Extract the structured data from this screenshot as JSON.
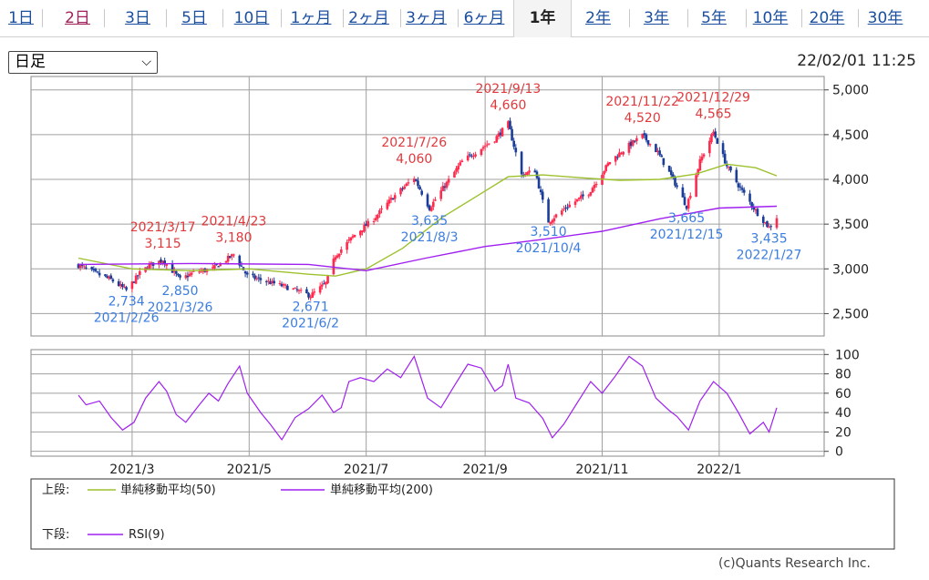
{
  "tabs": [
    {
      "label": "1日",
      "state": "link"
    },
    {
      "label": "2日",
      "state": "visited"
    },
    {
      "label": "3日",
      "state": "link"
    },
    {
      "label": "5日",
      "state": "link"
    },
    {
      "label": "10日",
      "state": "link"
    },
    {
      "label": "1ヶ月",
      "state": "link"
    },
    {
      "label": "2ヶ月",
      "state": "link"
    },
    {
      "label": "3ヶ月",
      "state": "link"
    },
    {
      "label": "6ヶ月",
      "state": "link"
    },
    {
      "label": "1年",
      "state": "active"
    },
    {
      "label": "2年",
      "state": "link"
    },
    {
      "label": "3年",
      "state": "link"
    },
    {
      "label": "5年",
      "state": "link"
    },
    {
      "label": "10年",
      "state": "link"
    },
    {
      "label": "20年",
      "state": "link"
    },
    {
      "label": "30年",
      "state": "link"
    }
  ],
  "period_select": {
    "value": "日足"
  },
  "timestamp": "22/02/01 11:25",
  "credit": "(c)Quants Research Inc.",
  "legend": {
    "upper_label": "上段:",
    "lower_label": "下段:",
    "sma50": "単純移動平均(50)",
    "sma200": "単純移動平均(200)",
    "rsi": "RSI(9)"
  },
  "colors": {
    "candle_up": "#ff2a4d",
    "candle_down": "#1b3d99",
    "sma50": "#9dc12d",
    "sma200": "#a020f0",
    "rsi": "#a020f0",
    "high_label": "#e0393c",
    "low_label": "#3b7de0",
    "grid": "#a0a0a0"
  },
  "chart_data": [
    {
      "type": "line",
      "subtype": "candlestick",
      "x_range": [
        "2021-02-01",
        "2022-01-31"
      ],
      "x_ticks": [
        "2021/3",
        "2021/5",
        "2021/7",
        "2021/9",
        "2021/11",
        "2022/1"
      ],
      "ylim": [
        2250,
        5150
      ],
      "y_ticks": [
        "5,000",
        "4,500",
        "4,000",
        "3,500",
        "3,000",
        "2,500"
      ],
      "y_tick_values": [
        5000,
        4500,
        4000,
        3500,
        3000,
        2500
      ],
      "price_path": [
        [
          "2021-02-01",
          3040
        ],
        [
          "2021-02-10",
          2950
        ],
        [
          "2021-02-18",
          2880
        ],
        [
          "2021-02-26",
          2760
        ],
        [
          "2021-03-05",
          2950
        ],
        [
          "2021-03-10",
          3040
        ],
        [
          "2021-03-17",
          3100
        ],
        [
          "2021-03-26",
          2880
        ],
        [
          "2021-04-02",
          2960
        ],
        [
          "2021-04-12",
          3000
        ],
        [
          "2021-04-23",
          3160
        ],
        [
          "2021-04-30",
          2920
        ],
        [
          "2021-05-10",
          2860
        ],
        [
          "2021-05-20",
          2800
        ],
        [
          "2021-06-02",
          2700
        ],
        [
          "2021-06-10",
          2840
        ],
        [
          "2021-06-15",
          3150
        ],
        [
          "2021-06-25",
          3380
        ],
        [
          "2021-07-05",
          3560
        ],
        [
          "2021-07-15",
          3800
        ],
        [
          "2021-07-26",
          4020
        ],
        [
          "2021-08-03",
          3680
        ],
        [
          "2021-08-10",
          3900
        ],
        [
          "2021-08-20",
          4200
        ],
        [
          "2021-08-30",
          4350
        ],
        [
          "2021-09-06",
          4450
        ],
        [
          "2021-09-13",
          4620
        ],
        [
          "2021-09-20",
          4050
        ],
        [
          "2021-09-27",
          4100
        ],
        [
          "2021-10-01",
          3750
        ],
        [
          "2021-10-04",
          3530
        ],
        [
          "2021-10-14",
          3700
        ],
        [
          "2021-10-25",
          3850
        ],
        [
          "2021-11-05",
          4200
        ],
        [
          "2021-11-15",
          4380
        ],
        [
          "2021-11-22",
          4490
        ],
        [
          "2021-11-30",
          4300
        ],
        [
          "2021-12-08",
          4000
        ],
        [
          "2021-12-15",
          3700
        ],
        [
          "2021-12-22",
          4200
        ],
        [
          "2021-12-29",
          4530
        ],
        [
          "2022-01-05",
          4150
        ],
        [
          "2022-01-12",
          3900
        ],
        [
          "2022-01-20",
          3650
        ],
        [
          "2022-01-27",
          3460
        ],
        [
          "2022-01-31",
          3580
        ]
      ],
      "series": [
        {
          "name": "単純移動平均(50)",
          "values": [
            [
              "2021-02-01",
              3120
            ],
            [
              "2021-03-01",
              3000
            ],
            [
              "2021-04-01",
              2980
            ],
            [
              "2021-05-01",
              3000
            ],
            [
              "2021-06-01",
              2940
            ],
            [
              "2021-06-15",
              2920
            ],
            [
              "2021-07-01",
              3000
            ],
            [
              "2021-07-20",
              3230
            ],
            [
              "2021-08-10",
              3580
            ],
            [
              "2021-09-01",
              3870
            ],
            [
              "2021-09-13",
              4030
            ],
            [
              "2021-10-01",
              4050
            ],
            [
              "2021-10-20",
              4020
            ],
            [
              "2021-11-10",
              3990
            ],
            [
              "2021-12-01",
              4000
            ],
            [
              "2021-12-20",
              4060
            ],
            [
              "2022-01-05",
              4170
            ],
            [
              "2022-01-20",
              4130
            ],
            [
              "2022-01-31",
              4040
            ]
          ]
        },
        {
          "name": "単純移動平均(200)",
          "values": [
            [
              "2021-02-01",
              3050
            ],
            [
              "2021-04-01",
              3060
            ],
            [
              "2021-06-01",
              3050
            ],
            [
              "2021-07-01",
              2980
            ],
            [
              "2021-08-01",
              3120
            ],
            [
              "2021-09-01",
              3250
            ],
            [
              "2021-10-01",
              3330
            ],
            [
              "2021-11-01",
              3420
            ],
            [
              "2021-12-01",
              3560
            ],
            [
              "2022-01-01",
              3680
            ],
            [
              "2022-01-31",
              3700
            ]
          ]
        }
      ],
      "annotations": [
        {
          "date": "2021/3/17",
          "value": "3,115",
          "kind": "high"
        },
        {
          "date": "2021/4/23",
          "value": "3,180",
          "kind": "high"
        },
        {
          "date": "2021/7/26",
          "value": "4,060",
          "kind": "high"
        },
        {
          "date": "2021/9/13",
          "value": "4,660",
          "kind": "high"
        },
        {
          "date": "2021/11/22",
          "value": "4,520",
          "kind": "high"
        },
        {
          "date": "2021/12/29",
          "value": "4,565",
          "kind": "high"
        },
        {
          "date": "2021/2/26",
          "value": "2,734",
          "kind": "low"
        },
        {
          "date": "2021/3/26",
          "value": "2,850",
          "kind": "low"
        },
        {
          "date": "2021/6/2",
          "value": "2,671",
          "kind": "low"
        },
        {
          "date": "2021/8/3",
          "value": "3,635",
          "kind": "low"
        },
        {
          "date": "2021/10/4",
          "value": "3,510",
          "kind": "low"
        },
        {
          "date": "2021/12/15",
          "value": "3,665",
          "kind": "low"
        },
        {
          "date": "2022/1/27",
          "value": "3,435",
          "kind": "low"
        }
      ]
    },
    {
      "type": "line",
      "ylim": [
        -5,
        105
      ],
      "y_ticks": [
        "100",
        "80",
        "60",
        "40",
        "20",
        "0"
      ],
      "y_tick_values": [
        100,
        80,
        60,
        40,
        20,
        0
      ],
      "series": [
        {
          "name": "RSI(9)",
          "values": [
            [
              "2021-02-01",
              58
            ],
            [
              "2021-02-05",
              48
            ],
            [
              "2021-02-12",
              52
            ],
            [
              "2021-02-18",
              35
            ],
            [
              "2021-02-24",
              22
            ],
            [
              "2021-03-02",
              30
            ],
            [
              "2021-03-08",
              55
            ],
            [
              "2021-03-15",
              72
            ],
            [
              "2021-03-19",
              62
            ],
            [
              "2021-03-24",
              38
            ],
            [
              "2021-03-29",
              30
            ],
            [
              "2021-04-05",
              48
            ],
            [
              "2021-04-10",
              60
            ],
            [
              "2021-04-15",
              52
            ],
            [
              "2021-04-20",
              70
            ],
            [
              "2021-04-26",
              88
            ],
            [
              "2021-04-30",
              60
            ],
            [
              "2021-05-07",
              40
            ],
            [
              "2021-05-12",
              28
            ],
            [
              "2021-05-18",
              12
            ],
            [
              "2021-05-25",
              35
            ],
            [
              "2021-06-01",
              44
            ],
            [
              "2021-06-08",
              58
            ],
            [
              "2021-06-14",
              40
            ],
            [
              "2021-06-18",
              45
            ],
            [
              "2021-06-22",
              72
            ],
            [
              "2021-06-28",
              76
            ],
            [
              "2021-07-05",
              72
            ],
            [
              "2021-07-12",
              85
            ],
            [
              "2021-07-19",
              76
            ],
            [
              "2021-07-26",
              98
            ],
            [
              "2021-08-02",
              55
            ],
            [
              "2021-08-09",
              45
            ],
            [
              "2021-08-16",
              68
            ],
            [
              "2021-08-23",
              90
            ],
            [
              "2021-08-30",
              86
            ],
            [
              "2021-09-06",
              62
            ],
            [
              "2021-09-10",
              68
            ],
            [
              "2021-09-13",
              90
            ],
            [
              "2021-09-17",
              55
            ],
            [
              "2021-09-24",
              50
            ],
            [
              "2021-10-01",
              34
            ],
            [
              "2021-10-06",
              14
            ],
            [
              "2021-10-12",
              28
            ],
            [
              "2021-10-19",
              50
            ],
            [
              "2021-10-26",
              72
            ],
            [
              "2021-11-01",
              60
            ],
            [
              "2021-11-08",
              78
            ],
            [
              "2021-11-15",
              98
            ],
            [
              "2021-11-22",
              88
            ],
            [
              "2021-11-29",
              55
            ],
            [
              "2021-12-06",
              42
            ],
            [
              "2021-12-10",
              36
            ],
            [
              "2021-12-16",
              22
            ],
            [
              "2021-12-22",
              52
            ],
            [
              "2021-12-29",
              72
            ],
            [
              "2022-01-05",
              60
            ],
            [
              "2022-01-11",
              40
            ],
            [
              "2022-01-17",
              18
            ],
            [
              "2022-01-24",
              30
            ],
            [
              "2022-01-27",
              20
            ],
            [
              "2022-01-31",
              45
            ]
          ]
        }
      ]
    }
  ]
}
